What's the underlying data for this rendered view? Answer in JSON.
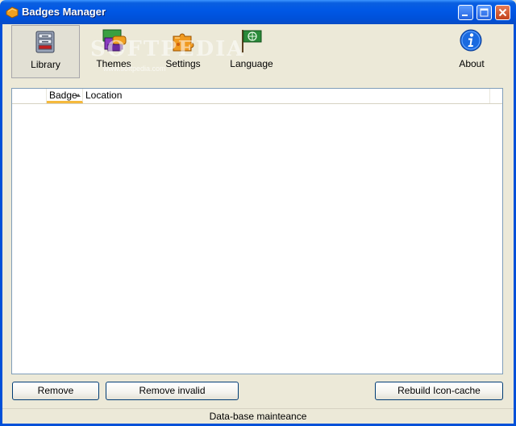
{
  "window": {
    "title": "Badges Manager"
  },
  "toolbar": {
    "items": [
      {
        "label": "Library",
        "icon": "library-icon",
        "active": true
      },
      {
        "label": "Themes",
        "icon": "themes-icon"
      },
      {
        "label": "Settings",
        "icon": "settings-icon"
      },
      {
        "label": "Language",
        "icon": "language-flag-icon"
      },
      {
        "label": "About",
        "icon": "about-info-icon"
      }
    ],
    "watermark": "SOFTPEDIA",
    "watermark_url": "www.softpedia.com"
  },
  "list": {
    "columns": [
      "",
      "Badge",
      "Location"
    ],
    "sorted_column": "Badge",
    "rows": []
  },
  "buttons": {
    "remove": "Remove",
    "remove_invalid": "Remove invalid",
    "rebuild": "Rebuild Icon-cache"
  },
  "status": {
    "text": "Data-base mainteance"
  },
  "colors": {
    "titlebar": "#0050d8",
    "accent_sort": "#f5b93c",
    "button_border": "#003c74"
  }
}
